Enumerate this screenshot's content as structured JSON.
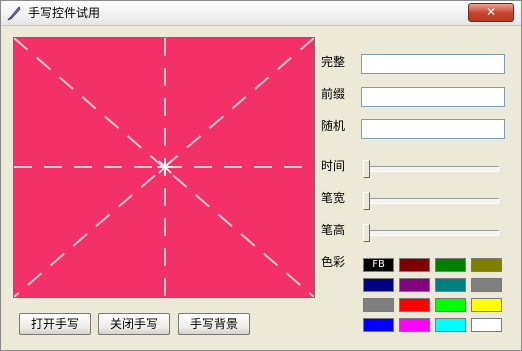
{
  "window": {
    "title": "手写控件试用",
    "close_symbol": "✕",
    "app_icon": "feather-pen-icon"
  },
  "fields": {
    "complete_label": "完整",
    "prefix_label": "前缀",
    "random_label": "随机"
  },
  "sliders": {
    "time_label": "时间",
    "pen_width_label": "笔宽",
    "pen_height_label": "笔高",
    "time_value": 0,
    "pen_width_value": 0,
    "pen_height_value": 0
  },
  "colors": {
    "label": "色彩",
    "selected_text": "FB",
    "swatches": [
      "#000000",
      "#800000",
      "#008000",
      "#808000",
      "#000080",
      "#800080",
      "#008080",
      "#808080",
      "#808080",
      "#ff0000",
      "#00ff00",
      "#ffff00",
      "#0000ff",
      "#ff00ff",
      "#00ffff",
      "#ffffff"
    ]
  },
  "canvas": {
    "background": "#f33068",
    "guide_color": "#f5c8d4"
  },
  "buttons": {
    "open": "打开手写",
    "close": "关闭手写",
    "background": "手写背景"
  }
}
